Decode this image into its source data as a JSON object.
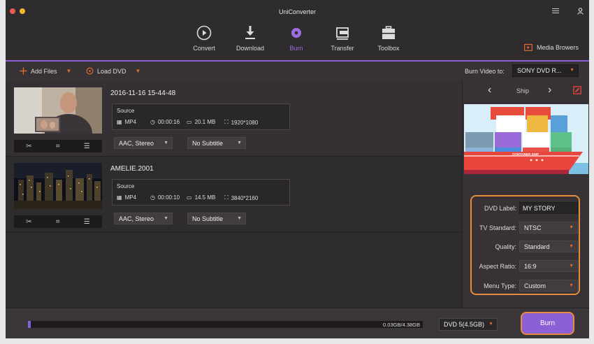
{
  "app": {
    "title": "UniConverter"
  },
  "nav": {
    "items": [
      {
        "label": "Convert",
        "icon": "convert-icon"
      },
      {
        "label": "Download",
        "icon": "download-icon"
      },
      {
        "label": "Burn",
        "icon": "burn-icon",
        "active": true
      },
      {
        "label": "Transfer",
        "icon": "transfer-icon"
      },
      {
        "label": "Toolbox",
        "icon": "toolbox-icon"
      }
    ],
    "media_browser": "Media Browers"
  },
  "toolbar": {
    "add_files": "Add Files",
    "load_dvd": "Load DVD",
    "burn_to_label": "Burn Video to:",
    "burn_to_value": "SONY DVD R..."
  },
  "files": [
    {
      "title": "2016-11-16 15-44-48",
      "source_label": "Source",
      "format": "MP4",
      "duration": "00:00:16",
      "size": "20.1 MB",
      "resolution": "1920*1080",
      "audio": "AAC, Stereo",
      "subtitle": "No Subtitle"
    },
    {
      "title": "AMELIE.2001",
      "source_label": "Source",
      "format": "MP4",
      "duration": "00:00:10",
      "size": "14.5 MB",
      "resolution": "3840*2160",
      "audio": "AAC, Stereo",
      "subtitle": "No Subtitle"
    }
  ],
  "template": {
    "name": "Ship",
    "ship_text": "CONTAINER SHIP"
  },
  "settings": {
    "dvd_label": {
      "label": "DVD Label:",
      "value": "MY STORY"
    },
    "tv_standard": {
      "label": "TV Standard:",
      "value": "NTSC"
    },
    "quality": {
      "label": "Quality:",
      "value": "Standard"
    },
    "aspect_ratio": {
      "label": "Aspect Ratio:",
      "value": "16:9"
    },
    "menu_type": {
      "label": "Menu Type:",
      "value": "Custom"
    }
  },
  "bottom": {
    "progress_text": "0.03GB/4.38GB",
    "progress_fraction": 0.007,
    "disc_type": "DVD 5(4.5GB)",
    "burn_label": "Burn"
  },
  "colors": {
    "accent": "#8b5fd6",
    "highlight": "#e88a3c",
    "caret": "#e26a2c"
  }
}
